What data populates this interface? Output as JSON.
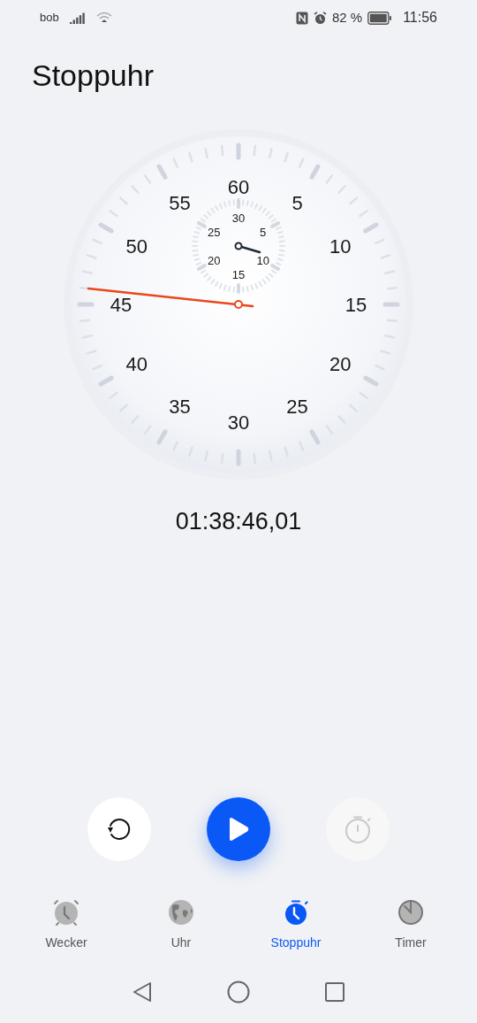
{
  "status_bar": {
    "carrier": "bob",
    "battery": "82 %",
    "time": "11:56"
  },
  "title": "Stoppuhr",
  "dial": {
    "numbers": [
      "60",
      "5",
      "10",
      "15",
      "20",
      "25",
      "30",
      "35",
      "40",
      "45",
      "50",
      "55"
    ],
    "subdial_numbers": [
      "30",
      "5",
      "10",
      "15",
      "20",
      "25"
    ]
  },
  "elapsed": "01:38:46,01",
  "controls": [
    {
      "kind": "reset",
      "disabled": false
    },
    {
      "kind": "play",
      "disabled": false
    },
    {
      "kind": "lap",
      "disabled": true
    }
  ],
  "tabs": [
    {
      "label": "Wecker",
      "kind": "alarm",
      "selected": false
    },
    {
      "label": "Uhr",
      "kind": "globe",
      "selected": false
    },
    {
      "label": "Stoppuhr",
      "kind": "stopwatch",
      "selected": true
    },
    {
      "label": "Timer",
      "kind": "timer",
      "selected": false
    }
  ]
}
